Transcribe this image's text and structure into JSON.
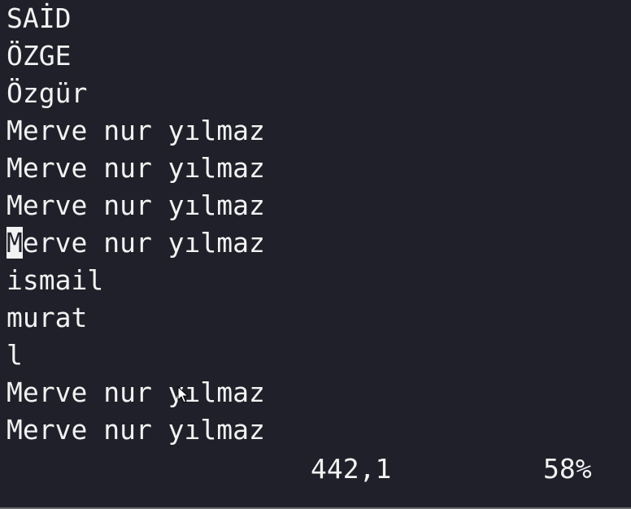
{
  "buffer": {
    "lines": [
      "SAİD",
      "ÖZGE",
      "Özgür",
      "Merve nur yılmaz",
      "Merve nur yılmaz",
      "Merve nur yılmaz",
      "Merve nur yılmaz",
      "ismail",
      "murat",
      "l",
      "Merve nur yılmaz",
      "Merve nur yılmaz"
    ],
    "cursor_line": 7,
    "cursor_column": 1
  },
  "status": {
    "position": "442,1",
    "scroll_percent": "58%"
  },
  "colors": {
    "background": "#1f2029",
    "foreground": "#f2f2f2",
    "cursor": "#f2f2f2"
  },
  "icons": {
    "mouse_pointer": "arrow-cursor-icon"
  }
}
